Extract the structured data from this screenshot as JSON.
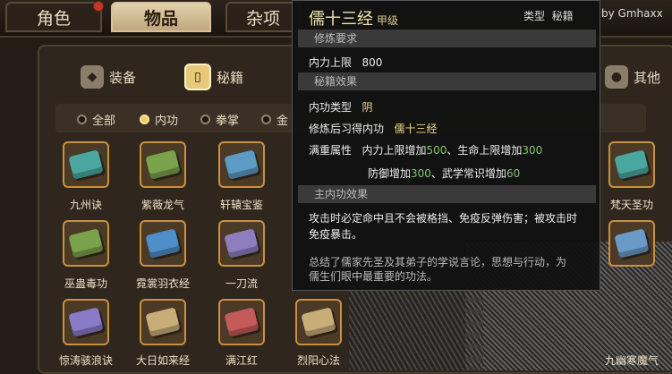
{
  "tabs": [
    {
      "label": "角色",
      "has_dot": true
    },
    {
      "label": "物品",
      "active": true
    },
    {
      "label": "杂项"
    }
  ],
  "watermark": "by Gmhaxx",
  "categories": [
    {
      "label": "装备",
      "icon": "armor-icon"
    },
    {
      "label": "秘籍",
      "icon": "scroll-icon",
      "selected": true
    },
    {
      "label": "其他",
      "icon": "misc-icon"
    }
  ],
  "filters": [
    {
      "label": "全部",
      "on": false
    },
    {
      "label": "内功",
      "on": true
    },
    {
      "label": "拳掌",
      "on": false
    },
    {
      "label": "金",
      "on": false
    }
  ],
  "items": [
    {
      "name": "九州诀",
      "color": "#4aa7a0"
    },
    {
      "name": "紫薇龙气",
      "color": "#7aa24a"
    },
    {
      "name": "轩辕宝鉴",
      "color": "#5b9bc4"
    },
    {
      "name": "巫蛊毒功",
      "color": "#7aa24a"
    },
    {
      "name": "霓裳羽衣经",
      "color": "#4e8fc9"
    },
    {
      "name": "一刀流",
      "color": "#8e7ec0"
    },
    {
      "name": "惊涛骇浪诀",
      "color": "#8a7bc8"
    },
    {
      "name": "大日如来经",
      "color": "#c8ad78"
    },
    {
      "name": "满江红",
      "color": "#c45a5a"
    },
    {
      "name": "烈阳心法",
      "color": "#c8ad78"
    },
    {
      "name": "梵天圣功",
      "color": "#4aa7a0"
    },
    {
      "name": "九幽寒魔气",
      "color": "#6a9ac8"
    }
  ],
  "tooltip": {
    "title": "儒十三经",
    "rank": "甲级",
    "type_label": "类型",
    "type_value": "秘籍",
    "sec_req": "修炼要求",
    "req_label": "内力上限",
    "req_value": "800",
    "sec_effect": "秘籍效果",
    "attr_label": "内功类型",
    "attr_value": "阴",
    "learn_label": "修炼后习得内功",
    "learn_value": "儒十三经",
    "full_label": "满重属性",
    "full_line1_a": "内力上限增加",
    "full_line1_b": "500",
    "full_line1_c": "、生命上限增加",
    "full_line1_d": "300",
    "full_line2_a": "防御增加",
    "full_line2_b": "300",
    "full_line2_c": "、武学常识增加",
    "full_line2_d": "60",
    "sec_main": "主内功效果",
    "main_desc": "攻击时必定命中且不会被格挡、免疫反弹伤害；被攻击时免疫暴击。",
    "lore": "总结了儒家先圣及其弟子的学说言论，思想与行动，为儒生们眼中最重要的功法。"
  }
}
